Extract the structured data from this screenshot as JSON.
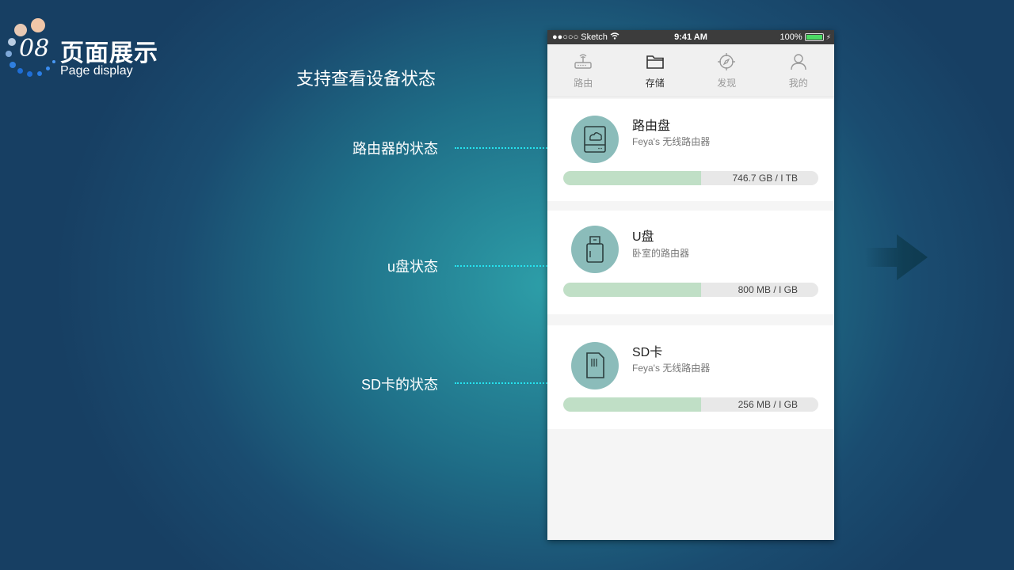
{
  "header": {
    "number": "08",
    "title": "页面展示",
    "subtitle": "Page display"
  },
  "feature_title": "支持查看设备状态",
  "callouts": [
    {
      "label": "路由器的状态"
    },
    {
      "label": "u盘状态"
    },
    {
      "label": "SD卡的状态"
    }
  ],
  "phone": {
    "statusbar": {
      "carrier": "●●○○○ Sketch",
      "time": "9:41 AM",
      "battery": "100%"
    },
    "tabs": [
      {
        "label": "路由",
        "icon": "router-icon",
        "active": false
      },
      {
        "label": "存储",
        "icon": "folder-icon",
        "active": true
      },
      {
        "label": "发现",
        "icon": "compass-icon",
        "active": false
      },
      {
        "label": "我的",
        "icon": "user-icon",
        "active": false
      }
    ],
    "storage_items": [
      {
        "title": "路由盘",
        "subtitle": "Feya's 无线路由器",
        "usage": "746.7 GB / I TB",
        "progress": 0.54,
        "icon": "cloud-drive-icon"
      },
      {
        "title": "U盘",
        "subtitle": "卧室的路由器",
        "usage": "800 MB / I GB",
        "progress": 0.54,
        "icon": "usb-drive-icon"
      },
      {
        "title": "SD卡",
        "subtitle": "Feya's 无线路由器",
        "usage": "256 MB / I GB",
        "progress": 0.54,
        "icon": "sd-card-icon"
      }
    ]
  },
  "colors": {
    "accent_callout": "#10e6f5",
    "icon_circle": "#8bbcba",
    "progress_fill": "#c0dfc6"
  }
}
